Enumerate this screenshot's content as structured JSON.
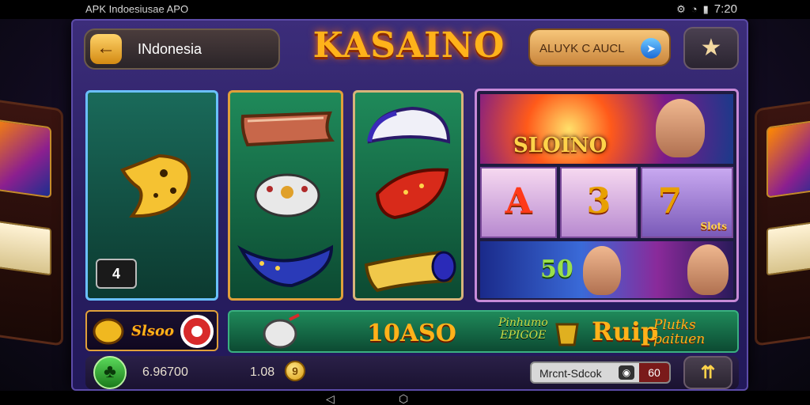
{
  "status_bar": {
    "title": "APK Indoesiusae APO",
    "time": "7:20"
  },
  "header": {
    "back_label": "INdonesia",
    "logo": "KASAINO",
    "account_label": "ALUYK C AUCL",
    "star_icon": "star-icon"
  },
  "tiles": [
    {
      "name": "tile-1",
      "badge": "4"
    },
    {
      "name": "tile-2"
    },
    {
      "name": "tile-3"
    }
  ],
  "feature": {
    "slot_title": "SLOINO",
    "reels": [
      "A",
      "3",
      "7"
    ],
    "reel_side_label": "Slots",
    "bottom_number": "50"
  },
  "bonus": {
    "left_label": "Slsoo",
    "amount": "10ASO",
    "promo1": "Pinhumo\nEPIGOE",
    "promo2": "Ruip",
    "promo3": "Plutks\npaituen"
  },
  "bottom_bar": {
    "balance": "6.96700",
    "coins": "1.08",
    "coin_symbol": "9",
    "mode_label": "Mrcnt-Sdcok",
    "mode_value": "60"
  },
  "colors": {
    "accent": "#ffb21a",
    "panel": "#2a2063",
    "tile_green": "#1f8a5a"
  }
}
